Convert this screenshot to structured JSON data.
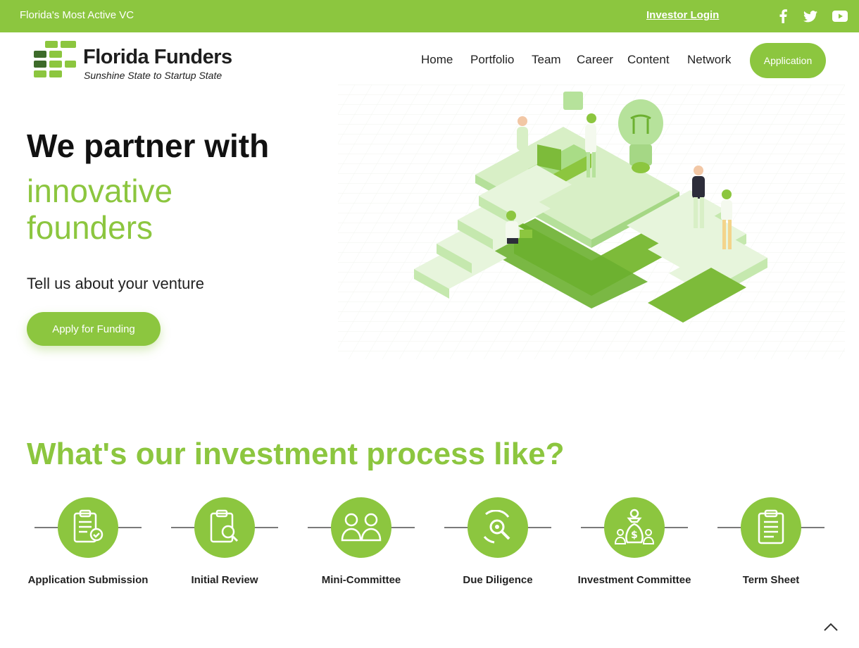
{
  "topbar": {
    "tagline": "Florida's Most Active VC",
    "investor_login": "Investor Login",
    "social_icons": [
      "facebook-icon",
      "twitter-icon",
      "youtube-icon"
    ]
  },
  "logo": {
    "name": "Florida Funders",
    "subtitle": "Sunshine State to Startup State"
  },
  "nav": {
    "items": [
      "Home",
      "Portfolio",
      "Team",
      "Career",
      "Content",
      "Network"
    ],
    "cta": "Application"
  },
  "hero": {
    "line1": "We partner with",
    "line2": "innovative founders",
    "subtitle": "Tell us about your venture",
    "button": "Apply for Funding"
  },
  "process": {
    "title": "What's our investment process like?",
    "steps": [
      {
        "label": "Application Submission",
        "icon": "clipboard-check-icon"
      },
      {
        "label": "Initial Review",
        "icon": "clipboard-search-icon"
      },
      {
        "label": "Mini-Committee",
        "icon": "two-people-icon"
      },
      {
        "label": "Due Diligence",
        "icon": "magnifier-icon"
      },
      {
        "label": "Investment Committee",
        "icon": "money-bag-people-icon"
      },
      {
        "label": "Term Sheet",
        "icon": "clipboard-icon"
      }
    ]
  },
  "colors": {
    "brand_green": "#8cc63f",
    "dark_text": "#1a1a1a"
  }
}
